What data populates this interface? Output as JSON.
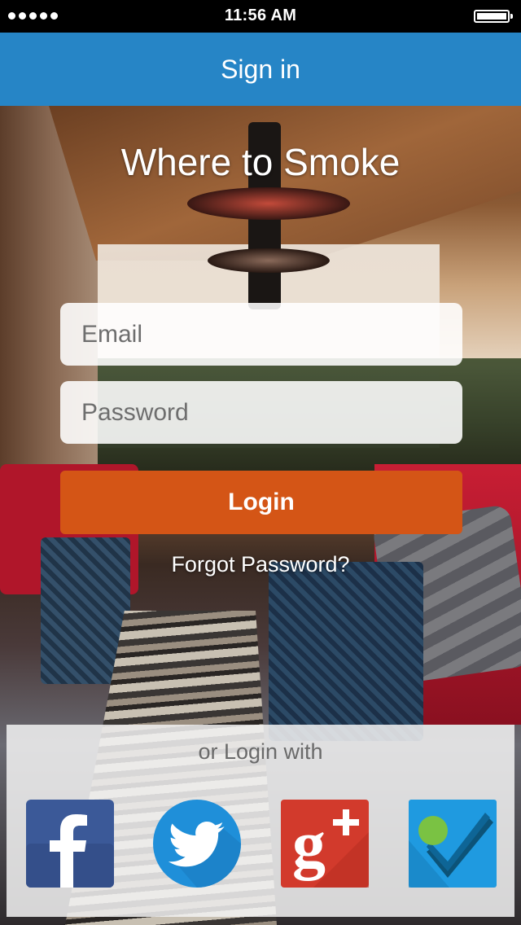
{
  "status_bar": {
    "time": "11:56 AM",
    "signal_dots": 5,
    "battery_level": 1.0
  },
  "nav": {
    "title": "Sign in"
  },
  "app": {
    "title": "Where to Smoke"
  },
  "form": {
    "email_placeholder": "Email",
    "email_value": "",
    "password_placeholder": "Password",
    "password_value": "",
    "login_label": "Login",
    "forgot_label": "Forgot Password?"
  },
  "social": {
    "caption": "or Login with",
    "providers": [
      {
        "name": "facebook-icon",
        "color": "#3b5998"
      },
      {
        "name": "twitter-icon",
        "color": "#1f8fd9"
      },
      {
        "name": "google-plus-icon",
        "color": "#d23a2c"
      },
      {
        "name": "foursquare-icon",
        "color": "#1f9ae0"
      }
    ]
  },
  "colors": {
    "nav_bar": "#2685c6",
    "login_button": "#d45516",
    "status_bar": "#000000"
  }
}
